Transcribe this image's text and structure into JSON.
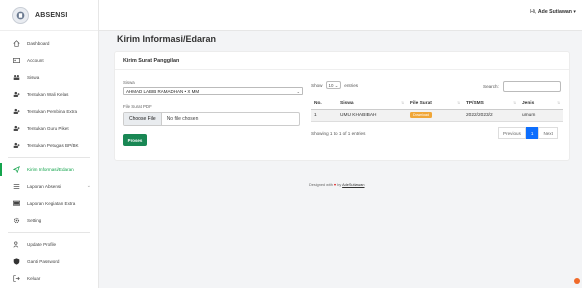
{
  "brand": {
    "title": "ABSENSI"
  },
  "topbar": {
    "greeting": "Hi, ",
    "user_name": "Ade Sutiawan",
    "caret": "▾"
  },
  "sidebar": {
    "items": [
      {
        "label": "Dashboard",
        "icon": "home-icon"
      },
      {
        "label": "Account",
        "icon": "id-card-icon"
      },
      {
        "label": "Siswa",
        "icon": "users-icon"
      },
      {
        "label": "Tentukan Wali Kelas",
        "icon": "user-plus-icon"
      },
      {
        "label": "Tentukan Pembina Extra",
        "icon": "user-plus-icon"
      },
      {
        "label": "Tentukan Guru Piket",
        "icon": "user-plus-icon"
      },
      {
        "label": "Tentukan Petugas BP/BK",
        "icon": "user-plus-icon"
      },
      {
        "label": "Kirim Informasi/Edaran",
        "icon": "send-icon"
      },
      {
        "label": "Laporan Absensi",
        "icon": "list-icon"
      },
      {
        "label": "Laporan Kegiatan Extra",
        "icon": "monitor-icon"
      },
      {
        "label": "Setting",
        "icon": "gear-icon"
      },
      {
        "label": "Update Profile",
        "icon": "user-edit-icon"
      },
      {
        "label": "Ganti Password",
        "icon": "shield-icon"
      },
      {
        "label": "Keluar",
        "icon": "logout-icon"
      }
    ]
  },
  "main": {
    "title": "Kirim Informasi/Edaran",
    "card_title": "Kirim Surat Panggilan",
    "form": {
      "siswa_label": "Siswa",
      "siswa_value": "AHMAD LABIB RAMADHAN • X MM",
      "file_label": "File Surat PDF",
      "file_button": "Choose File",
      "file_status": "No file chosen",
      "submit": "Proses"
    },
    "table": {
      "show_prefix": "Show",
      "show_value": "10",
      "show_suffix": "entries",
      "search_label": "Search:",
      "headers": [
        "No.",
        "Siswa",
        "File Surat",
        "TP/SMS",
        "Jenis"
      ],
      "rows": [
        {
          "no": "1",
          "siswa": "UMU KHABIBAH",
          "file": "Download",
          "tp": "2022/2023/2",
          "jenis": "umum"
        }
      ],
      "info": "Showing 1 to 1 of 1 entries",
      "pager": {
        "prev": "Previous",
        "page": "1",
        "next": "Next"
      }
    }
  },
  "footer": {
    "prefix": "Designed with",
    "by": "by",
    "author": "AdeSutiawan"
  },
  "colors": {
    "accent": "#198754",
    "primary": "#0d6efd",
    "badge": "#f0a637"
  }
}
